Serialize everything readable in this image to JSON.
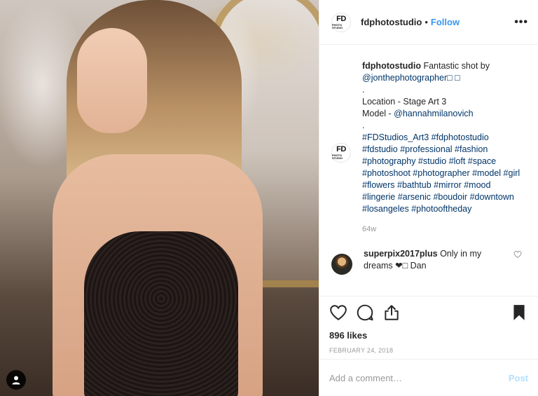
{
  "post": {
    "photo_alt": "Fashion photo of a woman in black lace bodysuit",
    "user_tag_icon": "person-icon"
  },
  "header": {
    "avatar_text": "FD",
    "avatar_sub": "PHOTO STUDIO",
    "username": "fdphotostudio",
    "separator": "•",
    "follow_label": "Follow",
    "more_label": "•••"
  },
  "caption": {
    "username": "fdphotostudio",
    "line1": " Fantastic shot by",
    "mention1": "@jonthephotographer□ □",
    "dot1": ".",
    "location": "Location - Stage Art 3",
    "model_prefix": "Model - ",
    "model_mention": "@hannahmilanovich",
    "dot2": ".",
    "hashtags": "#FDStudios_Art3 #fdphotostudio #fdstudio #professional #fashion #photography #studio #loft #space #photoshoot #photographer #model #girl #flowers #bathtub #mirror #mood #lingerie #arsenic #boudoir #downtown #losangeles #photooftheday",
    "time_ago": "64w"
  },
  "comment": {
    "username": "superpix2017plus",
    "text": " Only in my dreams ❤□ Dan"
  },
  "actions": {
    "likes": "896 likes",
    "date": "FEBRUARY 24, 2018"
  },
  "composer": {
    "placeholder": "Add a comment…",
    "post_label": "Post"
  },
  "colors": {
    "accent": "#3897f0",
    "link": "#003569",
    "muted": "#999999",
    "post_disabled": "#b2dffc"
  }
}
